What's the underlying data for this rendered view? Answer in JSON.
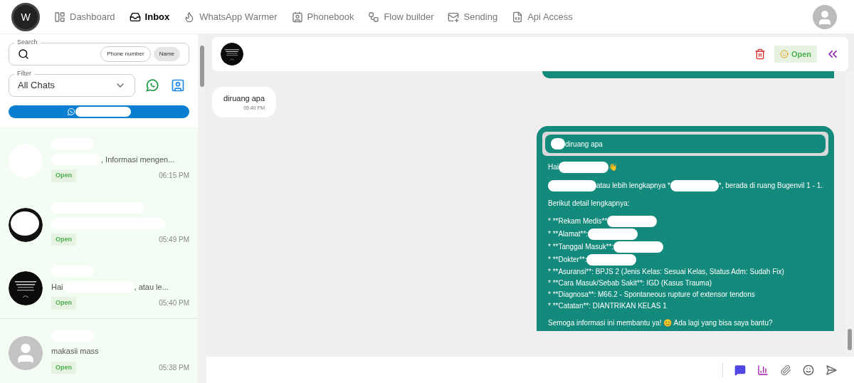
{
  "nav": {
    "logo": "W",
    "items": [
      {
        "label": "Dashboard",
        "selected": false
      },
      {
        "label": "Inbox",
        "selected": true
      },
      {
        "label": "WhatsApp Warmer",
        "selected": false
      },
      {
        "label": "Phonebook",
        "selected": false
      },
      {
        "label": "Flow builder",
        "selected": false
      },
      {
        "label": "Sending",
        "selected": false
      },
      {
        "label": "Api Access",
        "selected": false
      }
    ]
  },
  "sidebar": {
    "search": {
      "label": "Search",
      "modes": [
        {
          "label": "Phone number",
          "selected": false
        },
        {
          "label": "Name",
          "selected": true
        }
      ]
    },
    "filter": {
      "label": "Filter",
      "value": "All Chats"
    },
    "chats": [
      {
        "kind": "redacted",
        "preview": ", Informasi mengen...",
        "status": "Open",
        "time": "06:15 PM"
      },
      {
        "kind": "dark",
        "status": "Open",
        "time": "05:49 PM"
      },
      {
        "kind": "poster",
        "preview_prefix": "Hai",
        "preview": ", atau le...",
        "status": "Open",
        "time": "05:40 PM"
      },
      {
        "kind": "placeholder",
        "preview": "makasii mass",
        "status": "Open",
        "time": "05:38 PM"
      }
    ]
  },
  "chat": {
    "header": {
      "status": "Open"
    },
    "messages": [
      {
        "kind": "in",
        "text": "diruang apa",
        "time": "05:40 PM"
      },
      {
        "kind": "out",
        "quote": "diruang apa",
        "paragraphs": [
          [
            [
              {
                "text": "Hai"
              },
              {
                "kind": "redaction"
              },
              {
                "text": " 👋"
              }
            ]
          ],
          [
            [
              {
                "kind": "redaction"
              },
              {
                "text": "atau lebih lengkapnya *"
              },
              {
                "kind": "redaction"
              },
              {
                "text": "*, berada di ruang Bugenvil 1 - 1."
              }
            ]
          ],
          [
            [
              {
                "text": "Berikut detail lengkapnya:"
              }
            ]
          ],
          [
            [
              {
                "text": "* **Rekam Medis**"
              },
              {
                "kind": "redaction"
              }
            ],
            [
              {
                "text": "* **Alamat**:"
              },
              {
                "kind": "redaction"
              }
            ],
            [
              {
                "text": "* **Tanggal Masuk**:"
              },
              {
                "kind": "redaction"
              }
            ],
            [
              {
                "text": "* **Dokter**:"
              },
              {
                "kind": "redaction"
              }
            ],
            [
              {
                "text": "* **Asuransi**: BPJS 2 (Jenis Kelas: Sesuai Kelas, Status Adm: Sudah Fix)"
              }
            ],
            [
              {
                "text": "* **Cara Masuk/Sebab Sakit**: IGD (Kasus Trauma)"
              }
            ],
            [
              {
                "text": "* **Diagnosa**: M66.2 - Spontaneous rupture of extensor tendons"
              }
            ],
            [
              {
                "text": "* **Catatan**: DIANTRIKAN KELAS 1"
              }
            ]
          ],
          [
            [
              {
                "text": "Semoga informasi ini membantu ya! 😊 Ada lagi yang bisa saya bantu?"
              }
            ]
          ]
        ]
      }
    ]
  }
}
